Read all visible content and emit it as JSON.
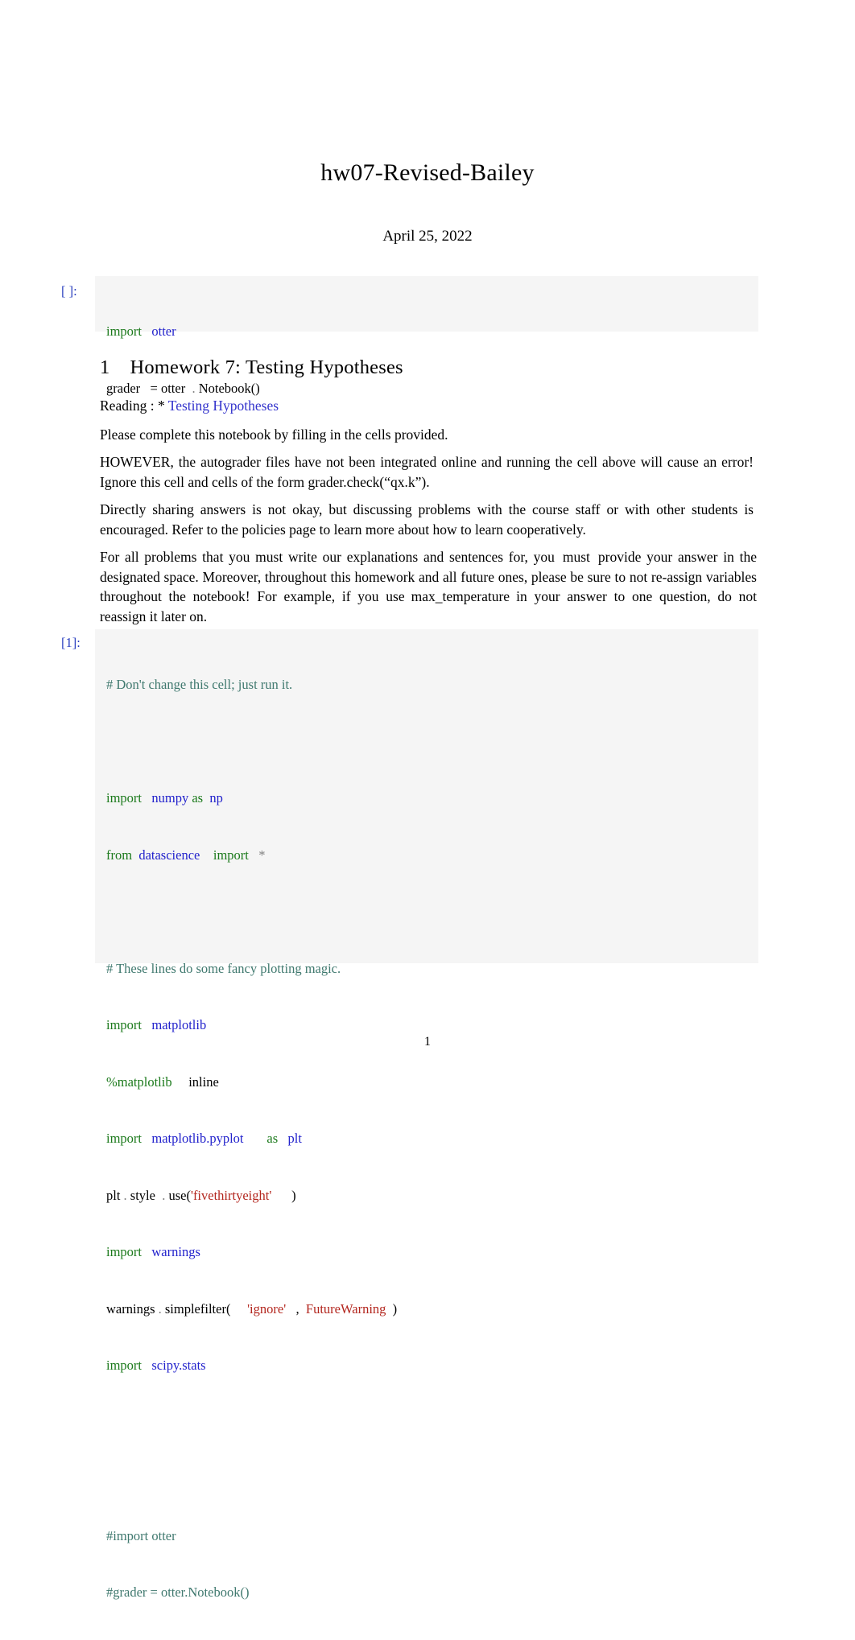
{
  "document": {
    "title": "hw07-Revised-Bailey",
    "date": "April 25, 2022",
    "page_number": "1"
  },
  "cell1": {
    "prompt": "[ ]:",
    "line1_kw": "import",
    "line1_mod": "otter",
    "line2_name": "grader",
    "line2_eq": "=",
    "line2_obj": "otter",
    "line2_dot": ".",
    "line2_call": "Notebook()"
  },
  "section": {
    "number": "1",
    "heading": "Homework 7: Testing Hypotheses",
    "reading_label": "Reading",
    "reading_colon": ": *",
    "reading_link": "Testing Hypotheses"
  },
  "paragraphs": {
    "p1": "Please complete this notebook by filling in the cells provided.",
    "p2": "HOWEVER, the autograder files have not been integrated online and running the cell above will cause an error! Ignore this cell and cells of the form grader.check(“qx.k”).",
    "p3": "Directly sharing answers is not okay, but discussing problems with the course staff or with other students is encouraged. Refer to the policies page to learn more about how to learn cooperatively.",
    "p4a": "For all problems that you must write our explanations and sentences for, you",
    "p4_must": "must",
    "p4b": "provide your answer in the designated space. Moreover, throughout this homework and all future ones, please be sure to not re-assign variables throughout the notebook! For example, if you use",
    "p4_var": "max_temperature",
    "p4c": "in your answer to one question, do not reassign it later on."
  },
  "cell2": {
    "prompt": "[1]:",
    "comment_top": "# Don't change this cell; just run it.",
    "l_import": "import",
    "l_from": "from",
    "l_as": "as",
    "numpy": "numpy",
    "np": "np",
    "datascience": "datascience",
    "star": "*",
    "comment_plot": "# These lines do some fancy plotting magic.",
    "matplotlib": "matplotlib",
    "magic_percent": "%",
    "magic_name": "matplotlib",
    "magic_arg": "inline",
    "pyplot": "matplotlib.pyplot",
    "plt": "plt",
    "style_obj": "plt",
    "style_dot1": ".",
    "style_attr": "style",
    "style_dot2": ".",
    "style_call": "use(",
    "style_arg": "'fivethirtyeight'",
    "style_close": ")",
    "warnings": "warnings",
    "warn_obj": "warnings",
    "warn_dot": ".",
    "warn_call": "simplefilter(",
    "warn_arg": "'ignore'",
    "warn_comma": ",",
    "warn_exc": "FutureWarning",
    "warn_close": ")",
    "scipy": "scipy.stats",
    "comment_otter1": "#import otter",
    "comment_otter2": "#grader = otter.Notebook()"
  },
  "colors": {
    "keyword": "#1c7a1c",
    "module": "#2222cc",
    "string": "#b3261e",
    "comment": "#40796f",
    "prompt": "#2a3fbf",
    "link": "#3333cc",
    "cell_background": "#f5f5f5"
  }
}
